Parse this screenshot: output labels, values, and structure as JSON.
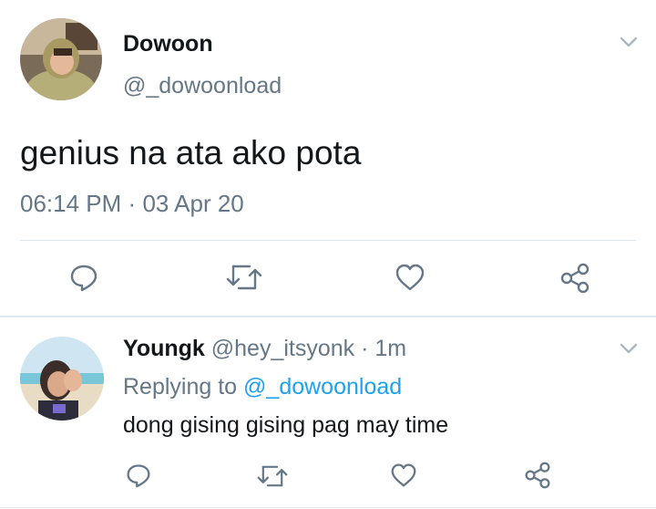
{
  "colors": {
    "accent": "#1da1f2",
    "secondary_text": "#657786",
    "icon": "#657786",
    "divider": "#e1e8ed"
  },
  "main_tweet": {
    "name": "Dowoon",
    "handle": "@_dowoonload",
    "text": "genius na ata ako pota",
    "time": "06:14 PM",
    "separator": "·",
    "date": "03 Apr 20",
    "actions": [
      "reply-icon",
      "retweet-icon",
      "like-icon",
      "share-icon"
    ]
  },
  "reply": {
    "name": "Youngk",
    "handle": "@hey_itsyonk",
    "separator": "·",
    "age": "1m",
    "replying_label": "Replying to",
    "replying_handle": "@_dowoonload",
    "text": "dong gising gising pag may time",
    "actions": [
      "reply-icon",
      "retweet-icon",
      "like-icon",
      "share-icon"
    ]
  }
}
